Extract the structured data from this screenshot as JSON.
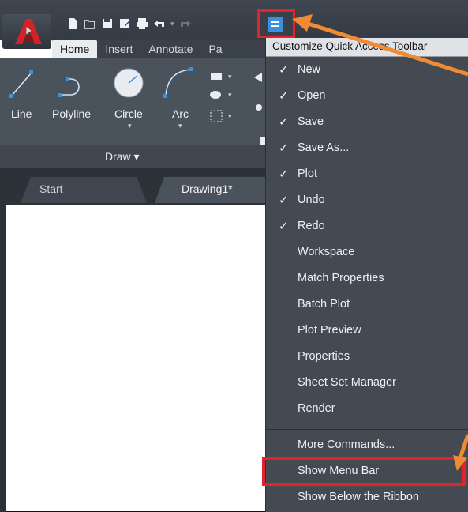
{
  "quick_access": {
    "customize_title": "Customize Quick Access Toolbar"
  },
  "ribbon": {
    "tabs": [
      "Home",
      "Insert",
      "Annotate",
      "Pa"
    ],
    "tools": [
      "Line",
      "Polyline",
      "Circle",
      "Arc"
    ],
    "panel_label": "Draw ▾"
  },
  "document_tabs": [
    "Start",
    "Drawing1*"
  ],
  "menu": {
    "items": [
      {
        "label": "New",
        "checked": true
      },
      {
        "label": "Open",
        "checked": true
      },
      {
        "label": "Save",
        "checked": true
      },
      {
        "label": "Save As...",
        "checked": true
      },
      {
        "label": "Plot",
        "checked": true
      },
      {
        "label": "Undo",
        "checked": true
      },
      {
        "label": "Redo",
        "checked": true
      },
      {
        "label": "Workspace",
        "checked": false
      },
      {
        "label": "Match Properties",
        "checked": false
      },
      {
        "label": "Batch Plot",
        "checked": false
      },
      {
        "label": "Plot Preview",
        "checked": false
      },
      {
        "label": "Properties",
        "checked": false
      },
      {
        "label": "Sheet Set Manager",
        "checked": false
      },
      {
        "label": "Render",
        "checked": false
      },
      {
        "label": "More Commands...",
        "checked": false
      },
      {
        "label": "Show Menu Bar",
        "checked": false
      },
      {
        "label": "Show Below the Ribbon",
        "checked": false
      }
    ],
    "check_glyph": "✓"
  },
  "colors": {
    "highlight_red": "#e2232a",
    "arrow_orange": "#f08a33",
    "menu_bg": "#434a52"
  }
}
